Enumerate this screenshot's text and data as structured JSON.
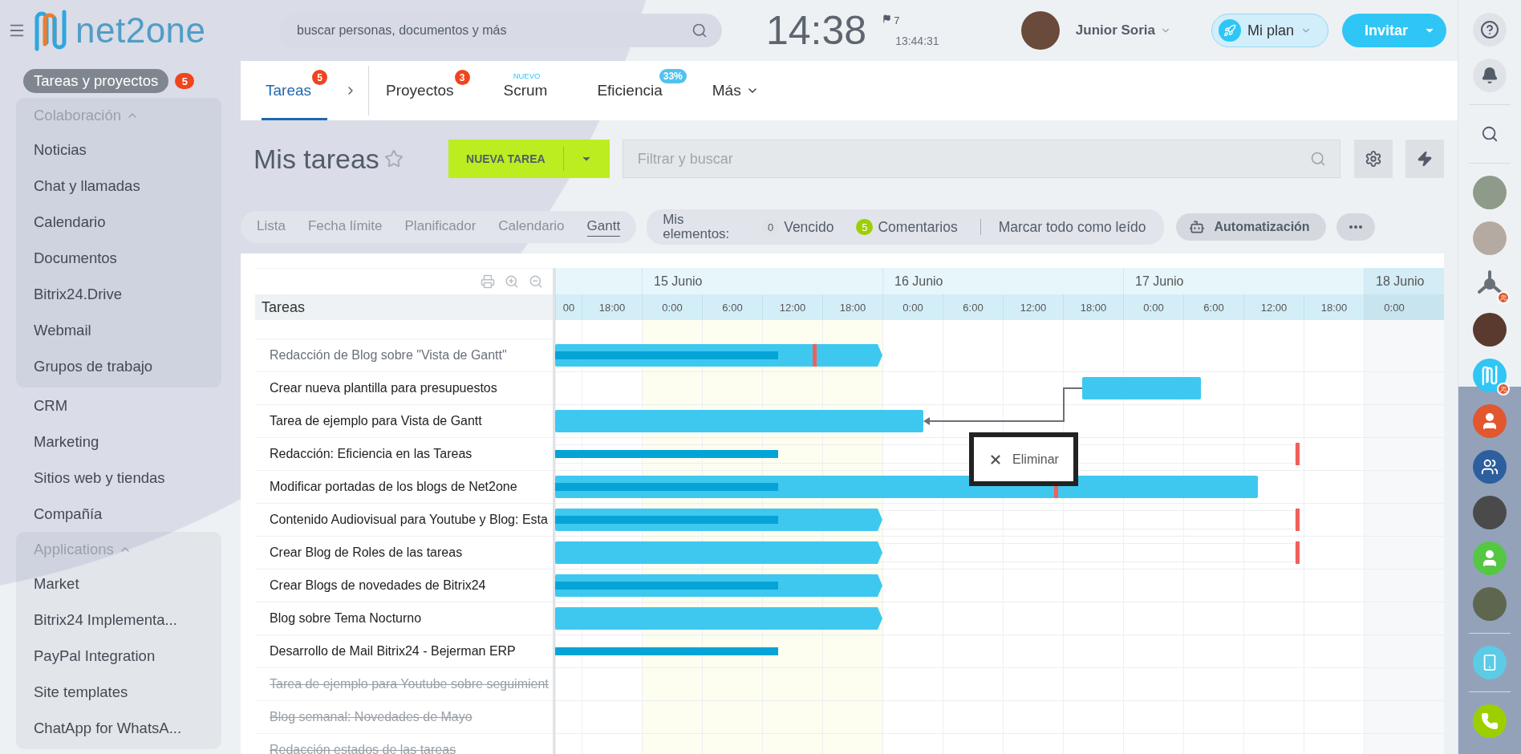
{
  "header": {
    "logo": "net2one",
    "search": {
      "placeholder": "buscar personas, documentos y más"
    },
    "clock": "14:38",
    "flag_count": "7",
    "time": "13:44:31",
    "user": {
      "name": "Junior Soria"
    },
    "plan_button": "Mi plan",
    "invite_button": "Invitar"
  },
  "sidebar": {
    "items": [
      {
        "kind": "link",
        "label": "Tareas y proyectos",
        "counter": "5",
        "selected": true
      },
      {
        "kind": "group",
        "label": "Colaboración",
        "expanded": true,
        "children": [
          {
            "label": "Noticias",
            "selected": false
          },
          {
            "label": "Chat y llamadas",
            "selected": false
          },
          {
            "label": "Calendario",
            "selected": false
          },
          {
            "label": "Documentos",
            "selected": false
          },
          {
            "label": "Bitrix24.Drive",
            "selected": false
          },
          {
            "label": "Webmail",
            "selected": false
          },
          {
            "label": "Grupos de trabajo",
            "selected": false
          }
        ]
      },
      {
        "kind": "link",
        "label": "CRM",
        "selected": false
      },
      {
        "kind": "link",
        "label": "Marketing",
        "selected": false
      },
      {
        "kind": "link",
        "label": "Sitios web y tiendas",
        "selected": false
      },
      {
        "kind": "link",
        "label": "Compañía",
        "selected": false
      },
      {
        "kind": "group",
        "label": "Applications",
        "expanded": true,
        "children": [
          {
            "label": "Market",
            "selected": false
          },
          {
            "label": "Bitrix24 Implementa...",
            "selected": false
          },
          {
            "label": "PayPal Integration",
            "selected": false
          },
          {
            "label": "Site templates",
            "selected": false
          },
          {
            "label": "ChatApp for WhatsA...",
            "selected": false
          }
        ]
      }
    ]
  },
  "tabs": [
    {
      "label": "Tareas",
      "selected": true,
      "badge": {
        "kind": "counter",
        "text": "5"
      }
    },
    {
      "label": "Proyectos",
      "selected": false,
      "badge": {
        "kind": "counter",
        "text": "3"
      }
    },
    {
      "label": "Scrum",
      "selected": false,
      "badge": {
        "kind": "tag",
        "text": "NUEVO"
      }
    },
    {
      "label": "Eficiencia",
      "selected": false,
      "badge": {
        "kind": "pill",
        "text": "33%"
      }
    },
    {
      "label": "Más",
      "selected": false
    }
  ],
  "page": {
    "title": "Mis tareas",
    "new_button": "NUEVA TAREA",
    "filter": {
      "placeholder": "Filtrar y buscar"
    }
  },
  "views": [
    {
      "label": "Lista",
      "selected": false
    },
    {
      "label": "Fecha límite",
      "selected": false
    },
    {
      "label": "Planificador",
      "selected": false
    },
    {
      "label": "Calendario",
      "selected": false
    },
    {
      "label": "Gantt",
      "selected": true
    }
  ],
  "my_items": {
    "label": "Mis elementos:",
    "counters": [
      {
        "count": "0",
        "label": "Vencido",
        "color": "#dfe3e8"
      },
      {
        "count": "5",
        "label": "Comentarios",
        "color": "#9dcf00"
      }
    ],
    "mark_read": "Marcar todo como leído"
  },
  "automation_button": "Automatización",
  "gantt": {
    "column_title": "Tareas",
    "days": [
      {
        "today": false,
        "weekend": false,
        "hours": [
          "00",
          "18:00"
        ]
      },
      {
        "label": "15 Junio",
        "today": true,
        "weekend": false,
        "hours": [
          "0:00",
          "6:00",
          "12:00",
          "18:00"
        ]
      },
      {
        "label": "16 Junio",
        "today": false,
        "weekend": false,
        "hours": [
          "0:00",
          "6:00",
          "12:00",
          "18:00"
        ]
      },
      {
        "label": "17 Junio",
        "today": false,
        "weekend": false,
        "hours": [
          "0:00",
          "6:00",
          "12:00",
          "18:00"
        ]
      },
      {
        "label": "18 Junio",
        "today": false,
        "weekend": true,
        "hours": [
          "0:00"
        ]
      }
    ],
    "tasks": [
      {
        "title": "Redacción de Blog sobre \"Vista de Gantt\"",
        "highlighted": true,
        "completed": false
      },
      {
        "title": "Crear nueva plantilla para presupuestos",
        "highlighted": false,
        "completed": false
      },
      {
        "title": "Tarea de ejemplo para Vista de Gantt",
        "highlighted": false,
        "completed": false
      },
      {
        "title": "Redacción: Eficiencia en las Tareas",
        "highlighted": false,
        "completed": false
      },
      {
        "title": "Modificar portadas de los blogs de Net2one",
        "highlighted": false,
        "completed": false
      },
      {
        "title": "Contenido Audiovisual para Youtube y Blog: Esta",
        "highlighted": false,
        "completed": false
      },
      {
        "title": "Crear Blog de Roles de las tareas",
        "highlighted": false,
        "completed": false
      },
      {
        "title": "Crear Blogs de novedades de Bitrix24",
        "highlighted": false,
        "completed": false
      },
      {
        "title": "Blog sobre Tema Nocturno",
        "highlighted": false,
        "completed": false
      },
      {
        "title": "Desarrollo de Mail Bitrix24 - Bejerman ERP",
        "highlighted": false,
        "completed": false
      },
      {
        "title": "Tarea de ejemplo para Youtube sobre seguimient",
        "highlighted": false,
        "completed": true
      },
      {
        "title": "Blog semanal: Novedades de Mayo",
        "highlighted": false,
        "completed": true
      },
      {
        "title": "Redacción estados de las tareas",
        "highlighted": false,
        "completed": true
      }
    ],
    "popup": {
      "action": "Eliminar"
    }
  }
}
